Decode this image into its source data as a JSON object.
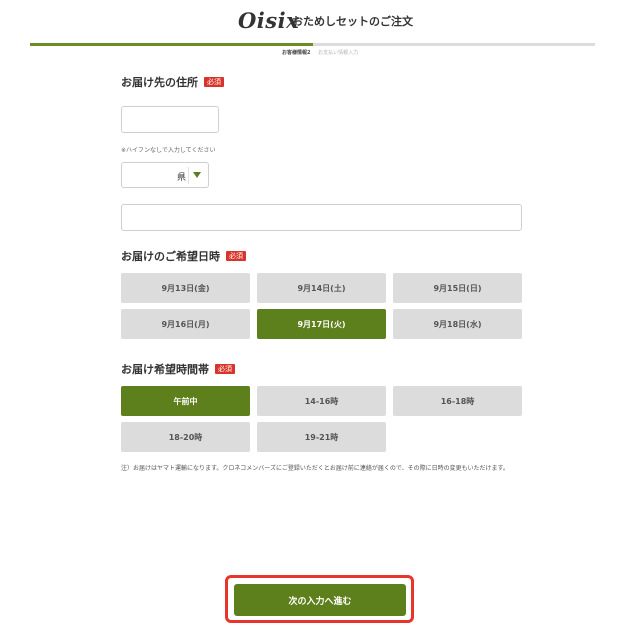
{
  "header": {
    "logo": "Oisix",
    "title": "おためしセットのご注文"
  },
  "progress": {
    "fraction": 0.5,
    "steps": [
      "お客様情報2",
      "お支払い情報入力"
    ]
  },
  "address": {
    "title": "お届け先の住所",
    "required_badge": "必須",
    "postal_placeholder": "",
    "postal_hint": "※ハイフンなしで入力してください",
    "prefecture_value": "県",
    "street_placeholder": ""
  },
  "delivery_date": {
    "title": "お届けのご希望日時",
    "required_badge": "必須",
    "options": [
      "9月13日(金)",
      "9月14日(土)",
      "9月15日(日)",
      "9月16日(月)",
      "9月17日(火)",
      "9月18日(水)"
    ],
    "selected": "9月17日(火)"
  },
  "delivery_time": {
    "title": "お届け希望時間帯",
    "required_badge": "必須",
    "options": [
      "午前中",
      "14-16時",
      "16-18時",
      "18-20時",
      "19-21時"
    ],
    "selected": "午前中"
  },
  "note": "注）お届けはヤマト運輸になります。クロネコメンバーズにご登録いただくとお届け前に連絡が届くので、その際に日時の変更もいただけます。",
  "next_button": {
    "label": "次の入力へ進む"
  },
  "colors": {
    "accent": "#5d7f1c",
    "required": "#d9342b",
    "highlight": "#e8342a"
  }
}
